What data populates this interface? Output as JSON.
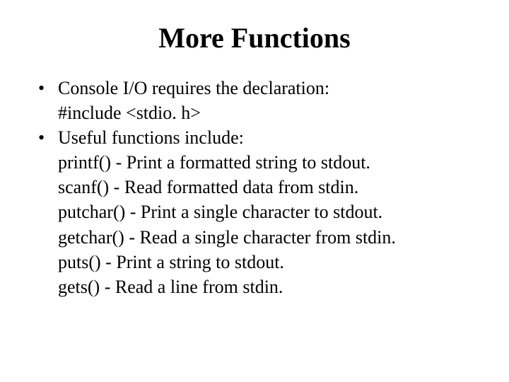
{
  "title": "More Functions",
  "bullets": [
    {
      "lead": "Console I/O requires the declaration:",
      "sublines": [
        "#include <stdio. h>"
      ]
    },
    {
      "lead": " Useful functions include:",
      "sublines": [
        "printf() -  Print a formatted string to stdout.",
        "scanf() -  Read formatted data from stdin.",
        "putchar() -  Print a single character to stdout.",
        "getchar() - Read a single character from stdin.",
        "puts() - Print a string to stdout.",
        "gets() - Read a line from stdin."
      ]
    }
  ]
}
